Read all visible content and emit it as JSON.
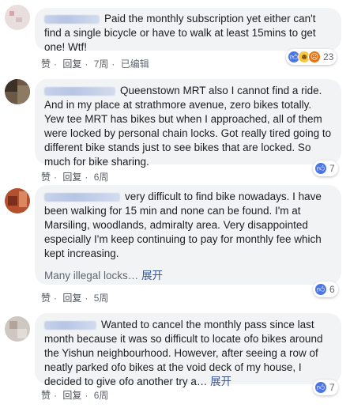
{
  "comments": [
    {
      "text": "Paid the monthly subscription yet either can't find a single bicycle or have to walk at least 15mins to get one! Wtf!",
      "more_link": "",
      "actions": {
        "like": "赞",
        "reply": "回复",
        "time": "7周",
        "edited": "已编辑"
      },
      "reactions": {
        "icons": [
          "like-icon",
          "haha-icon",
          "angry-icon"
        ],
        "count": "23"
      }
    },
    {
      "text": "Queenstown MRT also I cannot find a ride. And in my place at strathmore avenue, zero bikes totally. Yew tee MRT has bikes but when I approached, all of them were locked by personal chain locks. Got really tired going to different bike stands just to see bikes that are locked. So much for bike sharing.",
      "more_link": "",
      "actions": {
        "like": "赞",
        "reply": "回复",
        "time": "6周"
      },
      "reactions": {
        "icons": [
          "like-icon"
        ],
        "count": "7"
      }
    },
    {
      "text": "very difficult to find bike nowadays. I have been walking for 15 min and none can be found. I'm at Marsiling, woodlands, admiralty area. Very disappointed especially I'm keep continuing to pay for monthly fee which kept increasing.",
      "text2": "Many illegal locks…",
      "more_link": "展开",
      "actions": {
        "like": "赞",
        "reply": "回复",
        "time": "5周"
      },
      "reactions": {
        "icons": [
          "like-icon"
        ],
        "count": "6"
      }
    },
    {
      "text": "Wanted to cancel the monthly pass since last month because it was so difficult to locate ofo bikes around the Yishun neighbourhood. However, after seeing a row of neatly parked ofo bikes at the void deck of my house, I decided to give ofo another try a…",
      "more_link": "展开",
      "actions": {
        "like": "赞",
        "reply": "回复",
        "time": "6周"
      },
      "reactions": {
        "icons": [
          "like-icon"
        ],
        "count": "7"
      }
    }
  ],
  "colors": {
    "bubble": "#f2f3f5",
    "like_blue": "#4a76e8",
    "link": "#365899"
  }
}
